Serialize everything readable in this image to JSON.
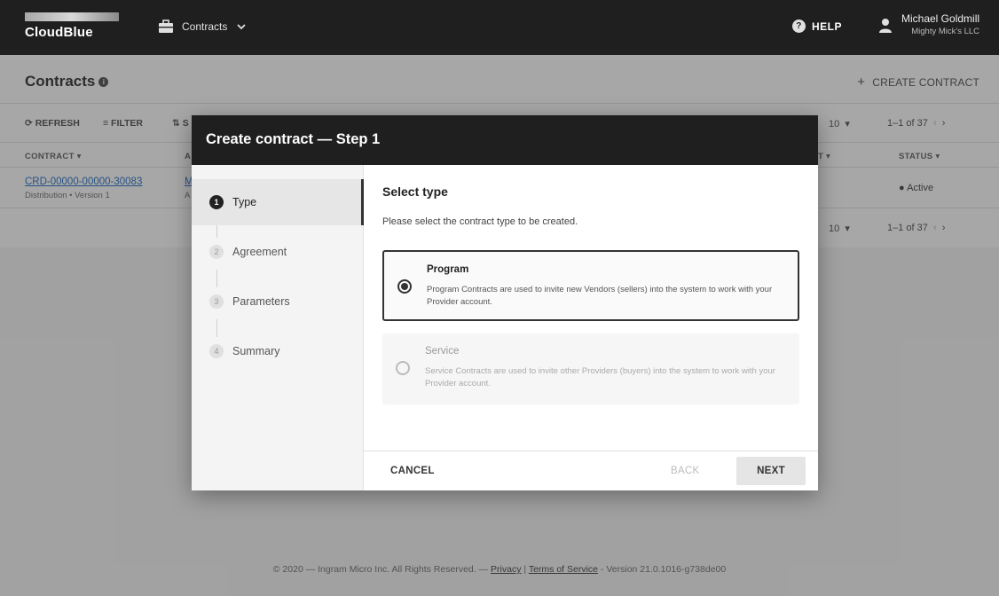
{
  "topbar": {
    "brand": "CloudBlue",
    "module": "Contracts",
    "help": "HELP",
    "user_name": "Michael Goldmill",
    "user_account": "Mighty Mick's LLC"
  },
  "page": {
    "title": "Contracts",
    "create_label": "CREATE CONTRACT"
  },
  "toolbar": {
    "refresh": "REFRESH",
    "filter": "FILTER",
    "sort_partial": "S",
    "per_page": "10",
    "range": "1–1 of 37"
  },
  "table": {
    "col_contract": "CONTRACT",
    "col_a": "A",
    "col_t": "T",
    "col_status": "STATUS",
    "row": {
      "id": "CRD-00000-00000-30083",
      "meta": "Distribution • Version 1",
      "col_a_1": "M",
      "col_a_2": "A",
      "status": "Active"
    }
  },
  "modal": {
    "title": "Create contract — Step 1",
    "steps": [
      {
        "num": "1",
        "label": "Type"
      },
      {
        "num": "2",
        "label": "Agreement"
      },
      {
        "num": "3",
        "label": "Parameters"
      },
      {
        "num": "4",
        "label": "Summary"
      }
    ],
    "heading": "Select type",
    "description": "Please select the contract type to be created.",
    "options": [
      {
        "title": "Program",
        "desc": "Program Contracts are used to invite new Vendors (sellers) into the system to work with your Provider account."
      },
      {
        "title": "Service",
        "desc": "Service Contracts are used to invite other Providers (buyers) into the system to work with your Provider account."
      }
    ],
    "cancel": "CANCEL",
    "back": "BACK",
    "next": "NEXT"
  },
  "footer": {
    "copyright": "© 2020 — Ingram Micro Inc. All Rights Reserved. — ",
    "privacy": "Privacy",
    "sep": " | ",
    "terms": "Terms of Service",
    "version": " - Version 21.0.1016-g738de00"
  }
}
